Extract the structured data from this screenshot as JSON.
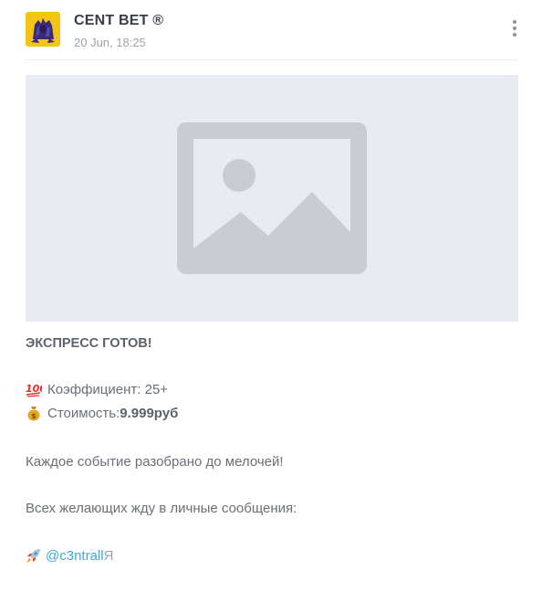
{
  "channel": {
    "name": "CENT BET ®",
    "date": "20 Jun, 18:25"
  },
  "post": {
    "headline": "ЭКСПРЕСС ГОТОВ!",
    "coefficient_label": "Коэффициент: 25+",
    "cost_label": "Стоимость: ",
    "cost_value": "9.999руб",
    "details": "Каждое событие разобрано до мелочей!",
    "invite": "Всех желающих жду в личные сообщения:",
    "contact_link": "@c3ntrall",
    "contact_suffix": "Я"
  },
  "icons": {
    "menu": "more-vertical-icon",
    "media_placeholder": "image-placeholder-icon",
    "coefficient_emoji": "hundred-points-icon",
    "cost_emoji": "money-bag-icon",
    "contact_emoji": "rocket-icon"
  },
  "colors": {
    "link": "#3ea9d8",
    "placeholder_bg": "#e8ebf2",
    "placeholder_icon": "#c9ccd3",
    "avatar_bg": "#f4c515"
  }
}
